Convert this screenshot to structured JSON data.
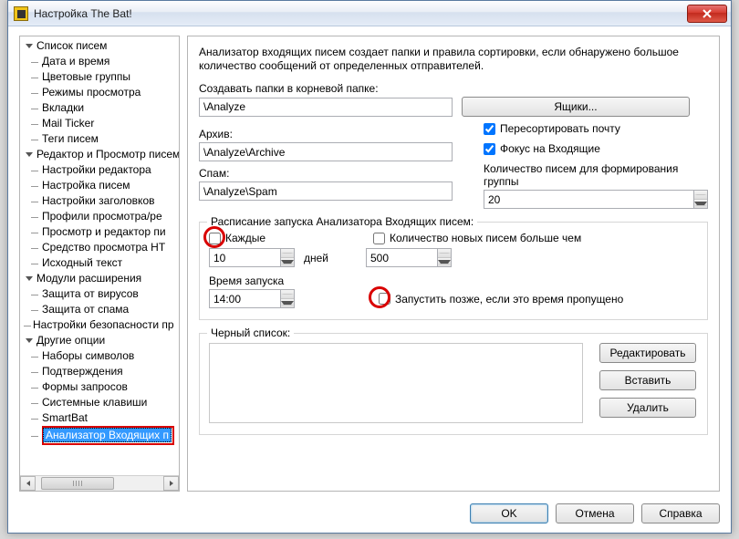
{
  "window": {
    "title": "Настройка The Bat!"
  },
  "tree": {
    "g1": "Список писем",
    "g1_items": [
      "Дата и время",
      "Цветовые группы",
      "Режимы просмотра",
      "Вкладки",
      "Mail Ticker",
      "Теги писем"
    ],
    "g2": "Редактор и Просмотр писем",
    "g2_items": [
      "Настройки редактора",
      "Настройка писем",
      "Настройки заголовков",
      "Профили просмотра/ре",
      "Просмотр и редактор пи",
      "Средство просмотра HT",
      "Исходный текст"
    ],
    "g3": "Модули расширения",
    "g3_items": [
      "Защита от вирусов",
      "Защита от спама"
    ],
    "g4leaf": "Настройки безопасности пр",
    "g5": "Другие опции",
    "g5_items": [
      "Наборы символов",
      "Подтверждения",
      "Формы запросов",
      "Системные клавиши",
      "SmartBat",
      "Анализатор Входящих п"
    ]
  },
  "right": {
    "desc": "Анализатор входящих писем создает папки и правила сортировки, если обнаружено большое количество сообщений от определенных отправителей.",
    "create_label": "Создавать папки в корневой папке:",
    "create_value": "\\Analyze",
    "boxes_btn": "Ящики...",
    "archive_label": "Архив:",
    "archive_value": "\\Analyze\\Archive",
    "spam_label": "Спам:",
    "spam_value": "\\Analyze\\Spam",
    "resort": "Пересортировать почту",
    "focus": "Фокус на Входящие",
    "count_label": "Количество писем для формирования группы",
    "count_value": "20",
    "schedule_legend": "Расписание запуска Анализатора Входящих писем:",
    "every": "Каждые",
    "days_value": "10",
    "days_unit": "дней",
    "newcount_label": "Количество новых писем больше чем",
    "newcount_value": "500",
    "runtime_label": "Время запуска",
    "runtime_value": "14:00",
    "runlater": "Запустить позже, если это время пропущено",
    "blacklist_legend": "Черный список:",
    "edit": "Редактировать",
    "insert": "Вставить",
    "delete": "Удалить"
  },
  "footer": {
    "ok": "OK",
    "cancel": "Отмена",
    "help": "Справка"
  }
}
